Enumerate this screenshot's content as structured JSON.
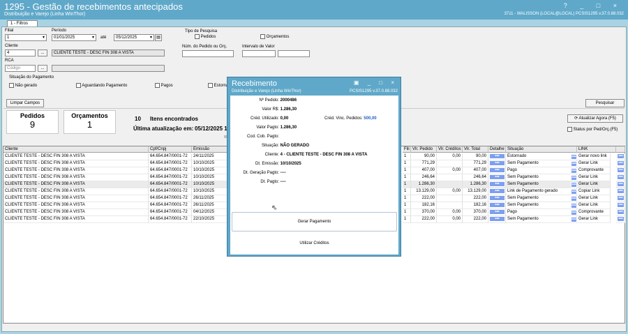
{
  "window": {
    "title": "1295 - Gestão de recebimentos antecipados",
    "subtitle": "Distribuição e Varejo (Linha WinThor)",
    "user": "3711 - WALISSON (LOCAL@LOCAL)   PCSIS1295 v.37.0.88.032",
    "tab": "1 - Filtros",
    "controls": "? _ □ ×"
  },
  "filters": {
    "filial_label": "Filial",
    "filial_value": "1",
    "periodo_label": "Período",
    "periodo_from": "01/01/2025",
    "ate_label": "até",
    "periodo_to": "05/12/2025",
    "cliente_label": "Cliente",
    "cliente_code": "4",
    "cliente_name": "CLIENTE TESTE - DESC FIN 308 A VISTA",
    "rca_label": "RCA",
    "rca_placeholder": "Código",
    "lookup_btn": "...",
    "tipo_pesquisa_label": "Tipo de Pesquisa",
    "pedidos_label": "Pedidos",
    "orcamentos_label": "Orçamentos",
    "num_pedido_label": "Núm. do Pedido ou Orç.",
    "intervalo_label": "Intervalo de Valor",
    "situacao_label": "Situação do Pagamento",
    "situacoes": [
      "Não gerado",
      "Aguardando Pagamento",
      "Pagos",
      "Estornados"
    ],
    "limpar": "Limpar Campos",
    "pesquisar": "Pesquisar"
  },
  "summary": {
    "pedidos_label": "Pedidos",
    "pedidos_value": "9",
    "orcamentos_label": "Orçamentos",
    "orcamentos_value": "1",
    "itens_count": "10",
    "itens_label": "Itens encontrados",
    "ultima_label": "Última atualização em:",
    "ultima_value": "05/12/2025 1",
    "atualizar_btn": "Atualizar Agora (F5)",
    "status_label": "Status por Ped/Orç.(F5)"
  },
  "grid": {
    "left_headers": [
      "Cliente",
      "Cpf/Cnpj",
      "Emissão"
    ],
    "right_headers": [
      "Fili",
      "Vlr. Pedido",
      "Vlr. Créditos",
      "Vlr. Total",
      "Detalhe",
      "Situação",
      "LINK"
    ],
    "rows": [
      {
        "cliente": "CLIENTE TESTE - DESC FIN 308 A VISTA",
        "cnpj": "64.654.847/0001-72",
        "emissao": "24/11/2025",
        "fil": "1",
        "vped": "90,00",
        "vcred": "0,00",
        "vtot": "90,00",
        "sit": "Estornado",
        "link": "Gerar novo link"
      },
      {
        "cliente": "CLIENTE TESTE - DESC FIN 308 A VISTA",
        "cnpj": "64.654.847/0001-72",
        "emissao": "10/10/2025",
        "fil": "1",
        "vped": "771,29",
        "vcred": "",
        "vtot": "771,29",
        "sit": "Sem Pagamento",
        "link": "Gerar Link"
      },
      {
        "cliente": "CLIENTE TESTE - DESC FIN 308 A VISTA",
        "cnpj": "64.654.847/0001-72",
        "emissao": "10/10/2025",
        "fil": "1",
        "vped": "407,00",
        "vcred": "0,00",
        "vtot": "407,00",
        "sit": "Pago",
        "link": "Comprovante"
      },
      {
        "cliente": "CLIENTE TESTE - DESC FIN 308 A VISTA",
        "cnpj": "64.654.847/0001-72",
        "emissao": "10/10/2025",
        "fil": "1",
        "vped": "246,64",
        "vcred": "",
        "vtot": "246,64",
        "sit": "Sem Pagamento",
        "link": "Gerar Link"
      },
      {
        "cliente": "CLIENTE TESTE - DESC FIN 308 A VISTA",
        "cnpj": "64.654.847/0001-72",
        "emissao": "10/10/2025",
        "fil": "1",
        "vped": "1.286,30",
        "vcred": "",
        "vtot": "1.286,30",
        "sit": "Sem Pagamento",
        "link": "Gerar Link"
      },
      {
        "cliente": "CLIENTE TESTE - DESC FIN 308 A VISTA",
        "cnpj": "64.654.847/0001-72",
        "emissao": "10/10/2025",
        "fil": "1",
        "vped": "13.129,00",
        "vcred": "0,00",
        "vtot": "13.129,00",
        "sit": "Link de Pagamento gerado",
        "link": "Copiar Link"
      },
      {
        "cliente": "CLIENTE TESTE - DESC FIN 308 A VISTA",
        "cnpj": "64.654.847/0001-72",
        "emissao": "26/11/2025",
        "fil": "1",
        "vped": "222,00",
        "vcred": "",
        "vtot": "222,00",
        "sit": "Sem Pagamento",
        "link": "Gerar Link"
      },
      {
        "cliente": "CLIENTE TESTE - DESC FIN 308 A VISTA",
        "cnpj": "64.654.847/0001-72",
        "emissao": "26/11/2025",
        "fil": "1",
        "vped": "182,16",
        "vcred": "",
        "vtot": "182,16",
        "sit": "Sem Pagamento",
        "link": "Gerar Link"
      },
      {
        "cliente": "CLIENTE TESTE - DESC FIN 308 A VISTA",
        "cnpj": "64.654.847/0001-72",
        "emissao": "04/12/2025",
        "fil": "1",
        "vped": "370,00",
        "vcred": "0,00",
        "vtot": "370,00",
        "sit": "Pago",
        "link": "Comprovante"
      },
      {
        "cliente": "CLIENTE TESTE - DESC FIN 308 A VISTA",
        "cnpj": "64.654.847/0001-72",
        "emissao": "22/10/2025",
        "fil": "1",
        "vped": "222,00",
        "vcred": "0,00",
        "vtot": "222,00",
        "sit": "Sem Pagamento",
        "link": "Gerar Link"
      }
    ],
    "dots": "•••"
  },
  "modal": {
    "title": "Recebimento",
    "subtitle": "Distribuição e Varejo (Linha WinThor)",
    "version": "PCSIS1295 v.37.0.88.032",
    "controls": "▣ _ □ ×",
    "num_pedido_label": "Nº Pedido:",
    "num_pedido": "2000486",
    "valor_label": "Valor R$:",
    "valor": "1.286,30",
    "cred_util_label": "Créd. Utilizado:",
    "cred_util": "0,00",
    "cred_vinc_label": "Créd. Vinc. Pedidos:",
    "cred_vinc": "500,00",
    "valor_pagto_label": "Valor Pagto:",
    "valor_pagto": "1.286,30",
    "cod_cob_label": "Cod. Cob. Pagto:",
    "situacao_label": "Situação:",
    "situacao": "NÃO GERADO",
    "cliente_label": "Cliente:",
    "cliente": "4 - CLIENTE TESTE - DESC FIN 308 A VISTA",
    "emissao_label": "Dt. Emissão:",
    "emissao": "10/10/2025",
    "geracao_label": "Dt. Geração Pagto:",
    "geracao": "----",
    "pagto_label": "Dt. Pagto:",
    "pagto": "----",
    "gerar_btn": "Gerar Pagamento",
    "utilizar_btn": "Utilizar Créditos"
  }
}
